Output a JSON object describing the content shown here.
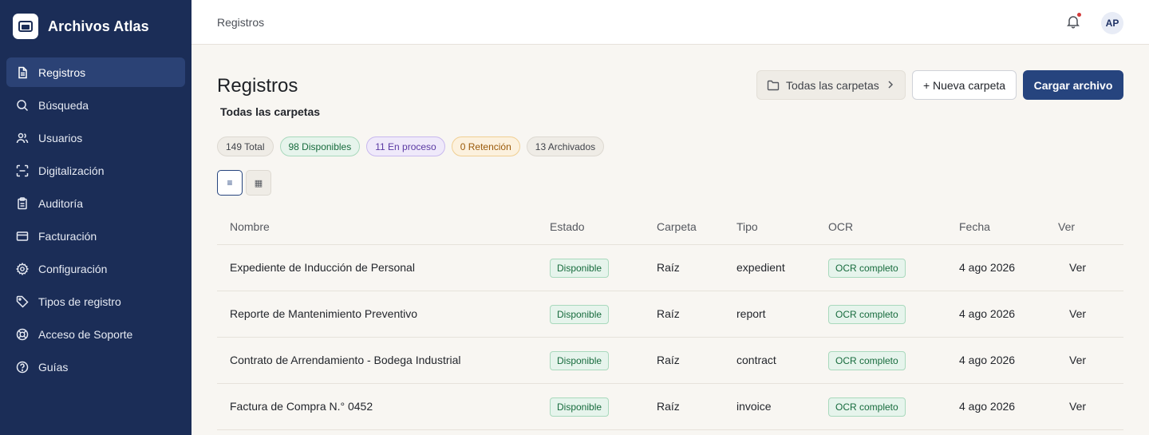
{
  "app": {
    "name": "Archivos Atlas"
  },
  "sidebar": {
    "items": [
      {
        "label": "Registros",
        "icon": "document-icon",
        "active": true
      },
      {
        "label": "Búsqueda",
        "icon": "search-icon",
        "active": false
      },
      {
        "label": "Usuarios",
        "icon": "users-icon",
        "active": false
      },
      {
        "label": "Digitalización",
        "icon": "scan-icon",
        "active": false
      },
      {
        "label": "Auditoría",
        "icon": "clipboard-icon",
        "active": false
      },
      {
        "label": "Facturación",
        "icon": "credit-card-icon",
        "active": false
      },
      {
        "label": "Configuración",
        "icon": "gear-icon",
        "active": false
      },
      {
        "label": "Tipos de registro",
        "icon": "tag-icon",
        "active": false
      },
      {
        "label": "Acceso de Soporte",
        "icon": "lifebuoy-icon",
        "active": false
      },
      {
        "label": "Guías",
        "icon": "help-circle-icon",
        "active": false
      }
    ]
  },
  "topbar": {
    "breadcrumb": "Registros",
    "avatar_initials": "AP"
  },
  "page": {
    "title": "Registros",
    "subtitle": "Todas las carpetas",
    "folder_button": "Todas las carpetas",
    "new_folder_button": "+ Nueva carpeta",
    "upload_button": "Cargar archivo"
  },
  "chips": {
    "total": "149 Total",
    "disponibles": "98 Disponibles",
    "en_proceso": "11 En proceso",
    "retencion": "0 Retención",
    "archivados": "13 Archivados"
  },
  "view_toggle": {
    "list_glyph": "≡",
    "grid_glyph": "▦"
  },
  "table": {
    "headers": {
      "nombre": "Nombre",
      "estado": "Estado",
      "carpeta": "Carpeta",
      "tipo": "Tipo",
      "ocr": "OCR",
      "fecha": "Fecha",
      "ver": "Ver"
    },
    "rows": [
      {
        "nombre": "Expediente de Inducción de Personal",
        "estado": "Disponible",
        "carpeta": "Raíz",
        "tipo": "expedient",
        "ocr": "OCR completo",
        "fecha": "4 ago 2026",
        "ver": "Ver"
      },
      {
        "nombre": "Reporte de Mantenimiento Preventivo",
        "estado": "Disponible",
        "carpeta": "Raíz",
        "tipo": "report",
        "ocr": "OCR completo",
        "fecha": "4 ago 2026",
        "ver": "Ver"
      },
      {
        "nombre": "Contrato de Arrendamiento - Bodega Industrial",
        "estado": "Disponible",
        "carpeta": "Raíz",
        "tipo": "contract",
        "ocr": "OCR completo",
        "fecha": "4 ago 2026",
        "ver": "Ver"
      },
      {
        "nombre": "Factura de Compra N.° 0452",
        "estado": "Disponible",
        "carpeta": "Raíz",
        "tipo": "invoice",
        "ocr": "OCR completo",
        "fecha": "4 ago 2026",
        "ver": "Ver"
      }
    ]
  },
  "colors": {
    "sidebar_bg": "#1b2d57",
    "primary": "#26447e",
    "success": "#176b3d",
    "page_bg": "#f8f6f2"
  }
}
